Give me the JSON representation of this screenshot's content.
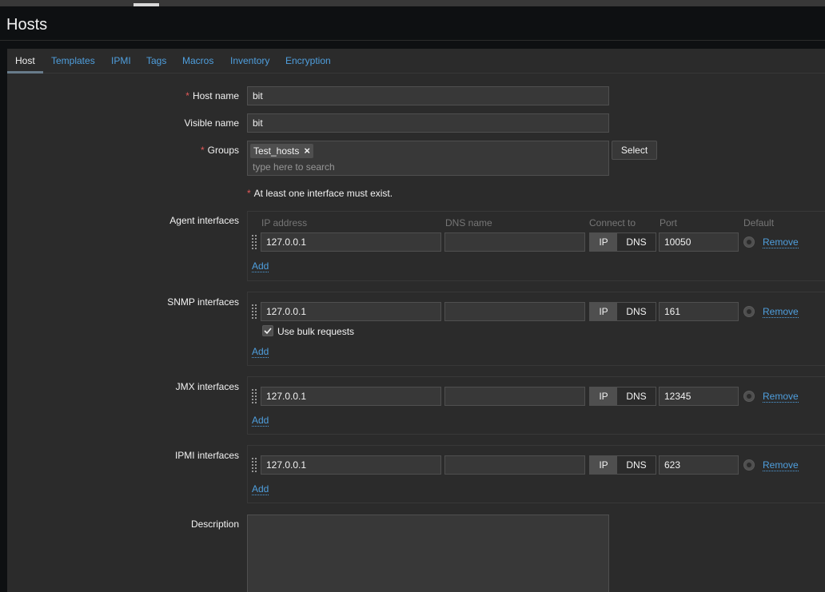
{
  "page": {
    "title": "Hosts"
  },
  "tabs": [
    {
      "label": "Host",
      "active": true
    },
    {
      "label": "Templates"
    },
    {
      "label": "IPMI"
    },
    {
      "label": "Tags"
    },
    {
      "label": "Macros"
    },
    {
      "label": "Inventory"
    },
    {
      "label": "Encryption"
    }
  ],
  "form": {
    "host_name": {
      "label": "Host name",
      "required": "*",
      "value": "bit"
    },
    "visible_name": {
      "label": "Visible name",
      "value": "bit"
    },
    "groups": {
      "label": "Groups",
      "required": "*",
      "chips": [
        "Test_hosts"
      ],
      "remove_icon": "×",
      "placeholder": "type here to search",
      "select_button": "Select"
    },
    "interface_note": {
      "required": "*",
      "text": "At least one interface must exist."
    },
    "columns": {
      "ip": "IP address",
      "dns": "DNS name",
      "connect": "Connect to",
      "port": "Port",
      "default": "Default"
    },
    "interfaces": {
      "agent": {
        "label": "Agent interfaces",
        "ip": "127.0.0.1",
        "dns": "",
        "connect_ip": "IP",
        "connect_dns": "DNS",
        "port": "10050",
        "remove": "Remove",
        "add": "Add"
      },
      "snmp": {
        "label": "SNMP interfaces",
        "ip": "127.0.0.1",
        "dns": "",
        "connect_ip": "IP",
        "connect_dns": "DNS",
        "port": "161",
        "remove": "Remove",
        "add": "Add",
        "bulk_label": "Use bulk requests",
        "bulk_checked": true
      },
      "jmx": {
        "label": "JMX interfaces",
        "ip": "127.0.0.1",
        "dns": "",
        "connect_ip": "IP",
        "connect_dns": "DNS",
        "port": "12345",
        "remove": "Remove",
        "add": "Add"
      },
      "ipmi": {
        "label": "IPMI interfaces",
        "ip": "127.0.0.1",
        "dns": "",
        "connect_ip": "IP",
        "connect_dns": "DNS",
        "port": "623",
        "remove": "Remove",
        "add": "Add"
      }
    },
    "description": {
      "label": "Description",
      "value": ""
    }
  },
  "colors": {
    "link": "#4f9fde",
    "required": "#e45959",
    "panel": "#2b2b2b",
    "input": "#383838"
  },
  "icons": {
    "drag": "drag-handle-icon",
    "remove": "close-icon",
    "check": "check-icon"
  }
}
